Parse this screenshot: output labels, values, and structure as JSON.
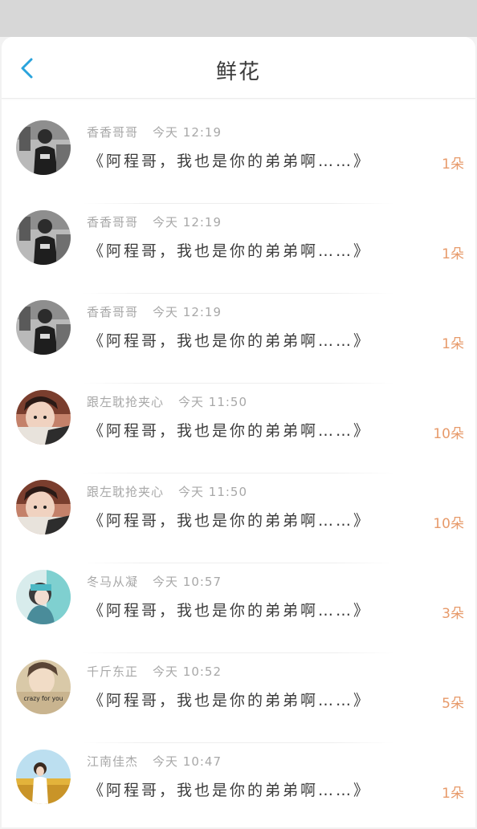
{
  "header": {
    "title": "鲜花",
    "back_icon": "chevron-left-icon",
    "accent_color": "#2aa3dc"
  },
  "count_color": "#e79a6a",
  "items": [
    {
      "name": "香香哥哥",
      "time": "今天 12:19",
      "message": "《阿程哥，我也是你的弟弟啊……》",
      "count": "1朵",
      "avatar": "photo-dark"
    },
    {
      "name": "香香哥哥",
      "time": "今天 12:19",
      "message": "《阿程哥，我也是你的弟弟啊……》",
      "count": "1朵",
      "avatar": "photo-dark"
    },
    {
      "name": "香香哥哥",
      "time": "今天 12:19",
      "message": "《阿程哥，我也是你的弟弟啊……》",
      "count": "1朵",
      "avatar": "photo-dark"
    },
    {
      "name": "跟左耽抢夹心",
      "time": "今天 11:50",
      "message": "《阿程哥，我也是你的弟弟啊……》",
      "count": "10朵",
      "avatar": "photo-face"
    },
    {
      "name": "跟左耽抢夹心",
      "time": "今天 11:50",
      "message": "《阿程哥，我也是你的弟弟啊……》",
      "count": "10朵",
      "avatar": "photo-face"
    },
    {
      "name": "冬马从凝",
      "time": "今天 10:57",
      "message": "《阿程哥，我也是你的弟弟啊……》",
      "count": "3朵",
      "avatar": "photo-teal"
    },
    {
      "name": "千斤东正",
      "time": "今天 10:52",
      "message": "《阿程哥，我也是你的弟弟啊……》",
      "count": "5朵",
      "avatar": "photo-crazy",
      "avatar_caption": "crazy for you"
    },
    {
      "name": "江南佳杰",
      "time": "今天 10:47",
      "message": "《阿程哥，我也是你的弟弟啊……》",
      "count": "1朵",
      "avatar": "photo-field"
    }
  ]
}
